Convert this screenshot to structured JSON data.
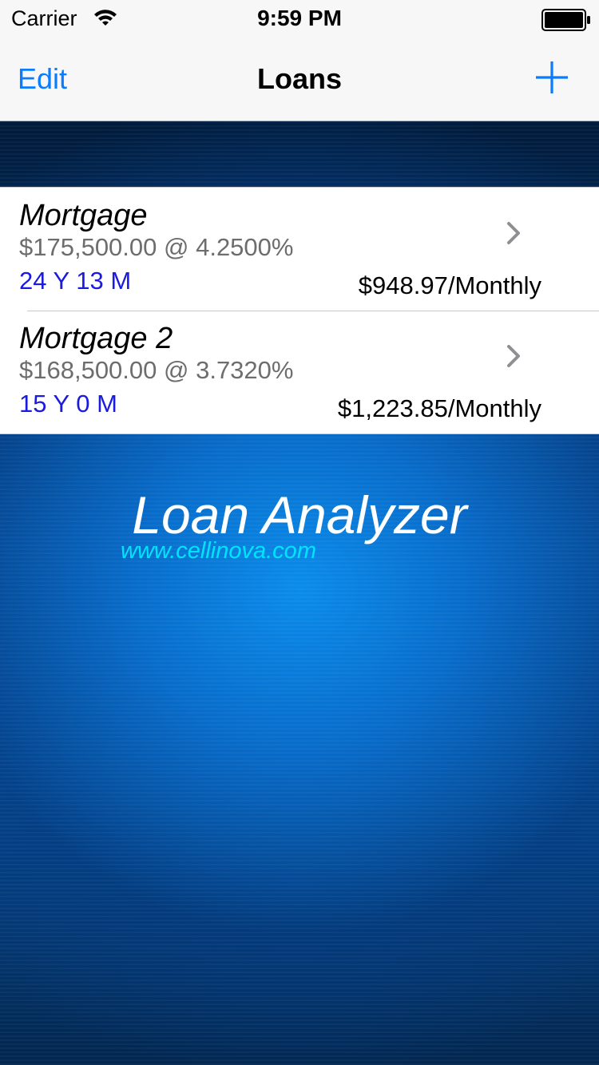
{
  "status_bar": {
    "carrier": "Carrier",
    "time": "9:59 PM",
    "wifi_icon": "wifi-icon",
    "battery_icon": "battery-icon"
  },
  "nav_bar": {
    "edit_label": "Edit",
    "title": "Loans",
    "add_icon": "plus-icon",
    "accent_color": "#0a7cff"
  },
  "loans": [
    {
      "name": "Mortgage",
      "amount_rate": "$175,500.00 @ 4.2500%",
      "term": "24 Y 13 M",
      "payment": "$948.97/Monthly"
    },
    {
      "name": "Mortgage 2",
      "amount_rate": "$168,500.00 @ 3.7320%",
      "term": "15 Y 0 M",
      "payment": "$1,223.85/Monthly"
    }
  ],
  "branding": {
    "title": "Loan Analyzer",
    "url": "www.cellinova.com"
  },
  "colors": {
    "term_text": "#1a1ae0",
    "url_text": "#00e5ff",
    "background_blue": "#0a4f9e"
  }
}
